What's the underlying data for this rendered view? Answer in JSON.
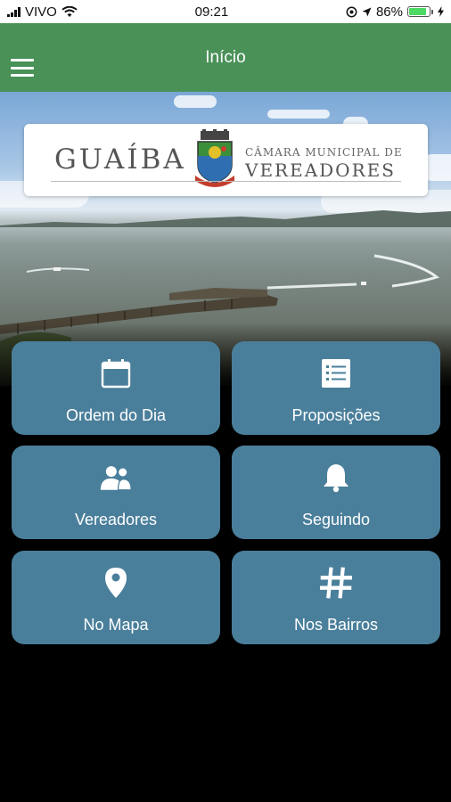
{
  "status_bar": {
    "carrier": "VIVO",
    "time": "09:21",
    "battery_percent": "86%",
    "battery_level": 0.86,
    "icons": [
      "signal-icon",
      "wifi-icon",
      "location-lock-icon",
      "location-arrow-icon",
      "battery-icon",
      "charging-icon"
    ]
  },
  "header": {
    "title": "Início",
    "menu_icon": "hamburger-menu-icon",
    "background_color": "#4a9158"
  },
  "hero": {
    "logo": {
      "city": "GUAÍBA",
      "line1": "CÂMARA MUNICIPAL DE",
      "line2": "VEREADORES",
      "crest_icon": "coat-of-arms-icon"
    }
  },
  "tiles": [
    {
      "label": "Ordem do Dia",
      "icon": "calendar-icon"
    },
    {
      "label": "Proposições",
      "icon": "list-icon"
    },
    {
      "label": "Vereadores",
      "icon": "users-icon"
    },
    {
      "label": "Seguindo",
      "icon": "bell-icon"
    },
    {
      "label": "No Mapa",
      "icon": "map-pin-icon"
    },
    {
      "label": "Nos Bairros",
      "icon": "hashtag-icon"
    }
  ],
  "colors": {
    "tile": "#4a7f9b",
    "header": "#4a9158",
    "background": "#000000"
  }
}
